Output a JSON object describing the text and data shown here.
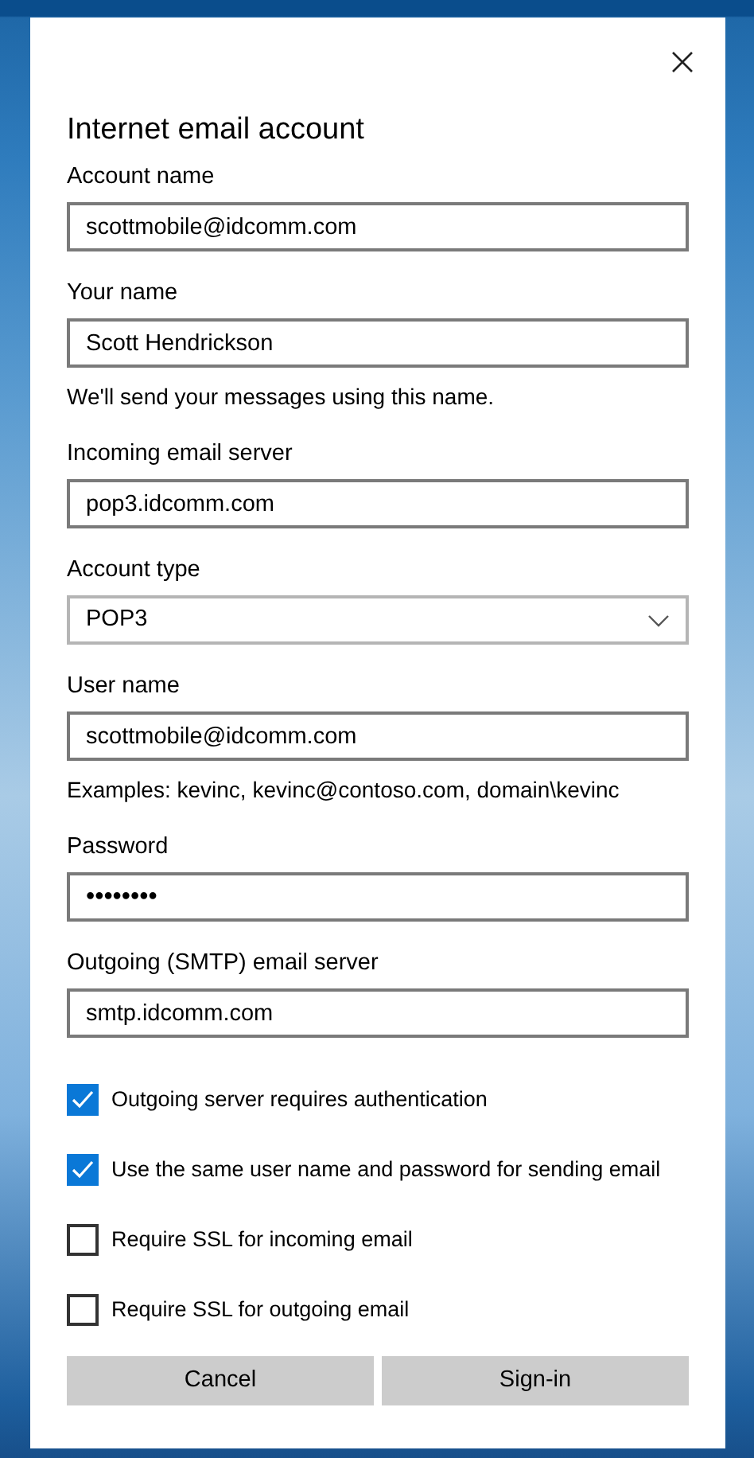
{
  "dialog": {
    "title": "Internet email account"
  },
  "fields": [
    {
      "kind": "text",
      "label": "Account name",
      "value": "scottmobile@idcomm.com"
    },
    {
      "kind": "text",
      "label": "Your name",
      "value": "Scott Hendrickson",
      "helper": "We'll send your messages using this name."
    },
    {
      "kind": "text",
      "label": "Incoming email server",
      "value": "pop3.idcomm.com"
    },
    {
      "kind": "select",
      "label": "Account type",
      "value": "POP3"
    },
    {
      "kind": "text",
      "label": "User name",
      "value": "scottmobile@idcomm.com",
      "helper": "Examples: kevinc, kevinc@contoso.com, domain\\kevinc"
    },
    {
      "kind": "password",
      "label": "Password",
      "value": "••••••••"
    },
    {
      "kind": "text",
      "label": "Outgoing (SMTP) email server",
      "value": "smtp.idcomm.com"
    }
  ],
  "checkboxes": [
    {
      "label": "Outgoing server requires authentication",
      "checked": true
    },
    {
      "label": "Use the same user name and password for sending email",
      "checked": true
    },
    {
      "label": "Require SSL for incoming email",
      "checked": false
    },
    {
      "label": "Require SSL for outgoing email",
      "checked": false
    }
  ],
  "buttons": [
    "Cancel",
    "Sign-in"
  ]
}
